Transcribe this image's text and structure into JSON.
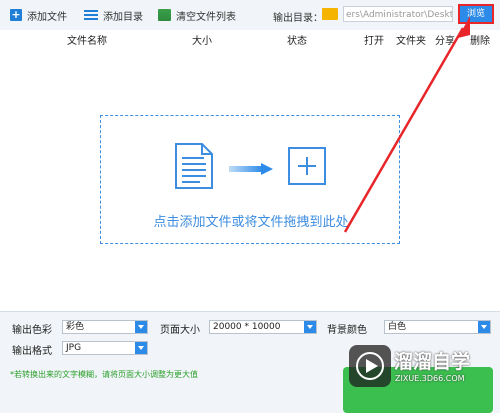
{
  "toolbar": {
    "add_file": "添加文件",
    "add_dir": "添加目录",
    "clear_list": "清空文件列表",
    "output_dir_label": "输出目录：",
    "output_path": "ers\\Administrator\\Deskto",
    "browse": "浏览"
  },
  "columns": {
    "name": "文件名称",
    "size": "大小",
    "status": "状态",
    "open": "打开",
    "folder": "文件夹",
    "share": "分享",
    "delete": "删除"
  },
  "drop_zone": {
    "text": "点击添加文件或将文件拖拽到此处"
  },
  "settings": {
    "color_label": "输出色彩",
    "color_value": "彩色",
    "page_size_label": "页面大小",
    "page_size_value": "20000 * 10000",
    "bg_color_label": "背景颜色",
    "bg_color_value": "白色",
    "format_label": "输出格式",
    "format_value": "JPG"
  },
  "note": "*若转换出来的文字模糊，请将页面大小调整为更大值",
  "watermark": {
    "brand": "溜溜自学",
    "url": "ZIXUE.3D66.COM"
  },
  "colors": {
    "accent": "#2c8ae8",
    "highlight": "#e8262a",
    "green": "#3bbf4f"
  }
}
